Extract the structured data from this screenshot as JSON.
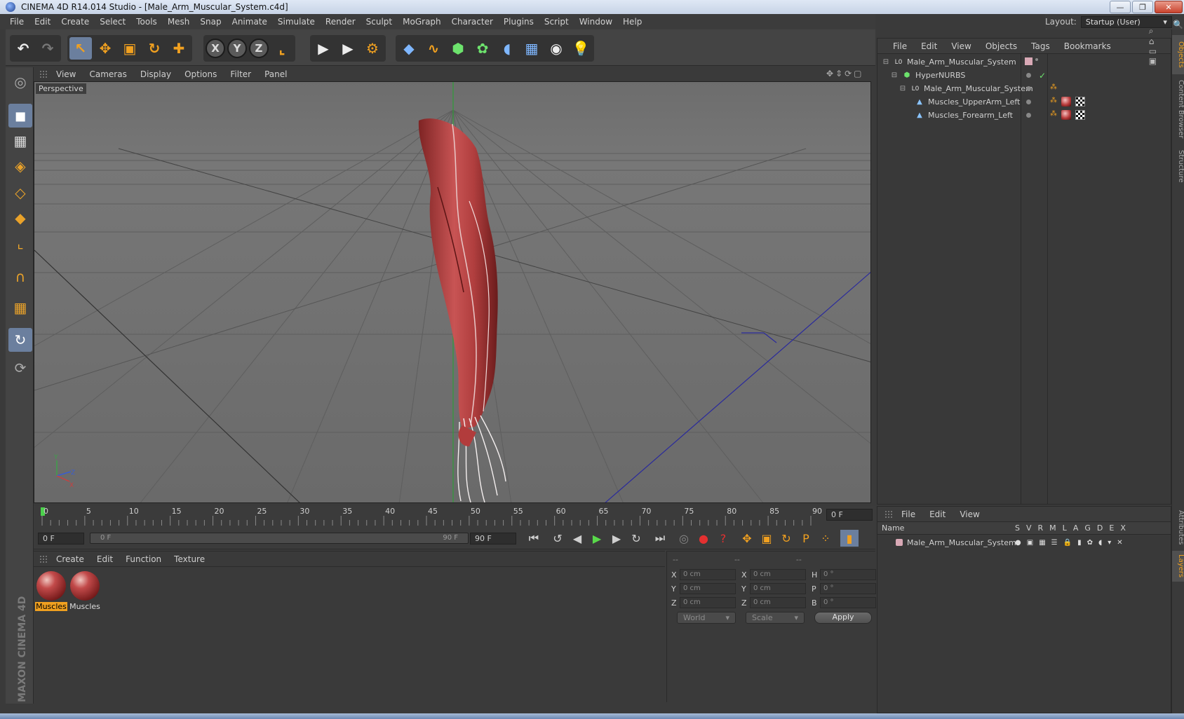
{
  "window": {
    "title": "CINEMA 4D R14.014 Studio - [Male_Arm_Muscular_System.c4d]",
    "minimize": "—",
    "restore": "❐",
    "close": "✕"
  },
  "menu": [
    "File",
    "Edit",
    "Create",
    "Select",
    "Tools",
    "Mesh",
    "Snap",
    "Animate",
    "Simulate",
    "Render",
    "Sculpt",
    "MoGraph",
    "Character",
    "Plugins",
    "Script",
    "Window",
    "Help"
  ],
  "layout": {
    "label": "Layout:",
    "value": "Startup (User)"
  },
  "toolbar": {
    "undo": "↶",
    "redo": "↷",
    "select": "↖",
    "move": "✥",
    "scale": "▣",
    "rotate": "↻",
    "add": "✚",
    "x": "X",
    "y": "Y",
    "z": "Z",
    "coord": "⌞",
    "render_view": "▶",
    "render_pv": "▶",
    "render_settings": "⚙",
    "cube": "◆",
    "spline": "∿",
    "nurbs": "⬢",
    "array": "✿",
    "deformer": "◖",
    "floor": "▦",
    "camera": "◉",
    "light": "💡"
  },
  "left_tools": [
    "◎",
    "◼",
    "▦",
    "◈",
    "◇",
    "◆",
    "⌞",
    "∩",
    "▦",
    "↻"
  ],
  "brand": "MAXON CINEMA 4D",
  "viewport": {
    "menu": [
      "View",
      "Cameras",
      "Display",
      "Options",
      "Filter",
      "Panel"
    ],
    "nav": "✥⇕⟳▢",
    "label": "Perspective",
    "axis_y": "Y",
    "axis_z": "Z",
    "axis_x": "X"
  },
  "timeline": {
    "ticks": [
      "0",
      "5",
      "10",
      "15",
      "20",
      "25",
      "30",
      "35",
      "40",
      "45",
      "50",
      "55",
      "60",
      "65",
      "70",
      "75",
      "80",
      "85",
      "90"
    ],
    "current_frame": "0 F",
    "start_field": "0 F",
    "slider_start": "0 F",
    "slider_end": "90 F",
    "end_field": "90 F"
  },
  "playback": {
    "first": "⏮",
    "prev_key": "↺",
    "prev": "◀",
    "play": "▶",
    "next": "▶",
    "next_key": "↻",
    "last": "⏭",
    "record": "◎",
    "auto_key": "●",
    "keyframe_help": "?",
    "key_move": "✥",
    "key_scale": "▣",
    "key_rotate": "↻",
    "key_param": "P",
    "key_pla": "⁘",
    "timeline_btn": "▮"
  },
  "materials": {
    "menu": [
      "Create",
      "Edit",
      "Function",
      "Texture"
    ],
    "items": [
      {
        "name": "Muscles",
        "selected": true
      },
      {
        "name": "Muscles",
        "selected": false
      }
    ]
  },
  "coordinates": {
    "headers": [
      "--",
      "--",
      "--"
    ],
    "rows": [
      {
        "l1": "X",
        "v1": "0 cm",
        "l2": "X",
        "v2": "0 cm",
        "l3": "H",
        "v3": "0 °"
      },
      {
        "l1": "Y",
        "v1": "0 cm",
        "l2": "Y",
        "v2": "0 cm",
        "l3": "P",
        "v3": "0 °"
      },
      {
        "l1": "Z",
        "v1": "0 cm",
        "l2": "Z",
        "v2": "0 cm",
        "l3": "B",
        "v3": "0 °"
      }
    ],
    "space": "World",
    "mode": "Scale",
    "apply": "Apply"
  },
  "objects": {
    "menu": [
      "File",
      "Edit",
      "View",
      "Objects",
      "Tags",
      "Bookmarks"
    ],
    "tree": [
      {
        "name": "Male_Arm_Muscular_System",
        "icon": "L0"
      },
      {
        "name": "HyperNURBS",
        "icon": "⬢"
      },
      {
        "name": "Male_Arm_Muscular_System",
        "icon": "L0"
      },
      {
        "name": "Muscles_UpperArm_Left",
        "icon": "▲"
      },
      {
        "name": "Muscles_Forearm_Left",
        "icon": "▲"
      }
    ],
    "check": "✓"
  },
  "layers": {
    "menu": [
      "File",
      "Edit",
      "View"
    ],
    "name_header": "Name",
    "columns": [
      "S",
      "V",
      "R",
      "M",
      "L",
      "A",
      "G",
      "D",
      "E",
      "X"
    ],
    "rows": [
      {
        "name": "Male_Arm_Muscular_System",
        "color": "#d9a9b6"
      }
    ]
  },
  "side_tabs": [
    "Objects",
    "Content Browser",
    "Structure",
    "Attributes",
    "Layers"
  ],
  "search": "🔍"
}
